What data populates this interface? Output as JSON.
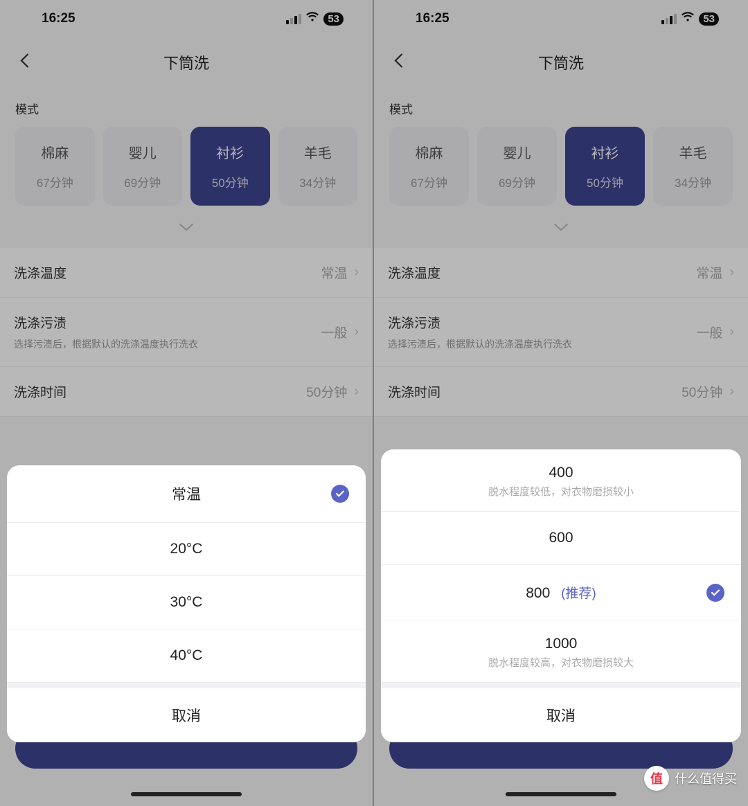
{
  "status": {
    "time": "16:25",
    "battery": "53"
  },
  "nav": {
    "title": "下筒洗"
  },
  "mode_section": {
    "label": "模式",
    "cards": [
      {
        "name": "棉麻",
        "time": "67分钟"
      },
      {
        "name": "婴儿",
        "time": "69分钟"
      },
      {
        "name": "衬衫",
        "time": "50分钟"
      },
      {
        "name": "羊毛",
        "time": "34分钟"
      }
    ]
  },
  "settings": {
    "wash_temp_label": "洗涤温度",
    "wash_temp_value": "常温",
    "wash_stain_label": "洗涤污渍",
    "wash_stain_desc": "选择污渍后，根据默认的洗涤温度执行洗衣",
    "wash_stain_value": "一般",
    "wash_time_label": "洗涤时间",
    "wash_time_value": "50分钟"
  },
  "sheet_left": {
    "items": [
      {
        "label": "常温",
        "checked": true
      },
      {
        "label": "20°C"
      },
      {
        "label": "30°C"
      },
      {
        "label": "40°C"
      }
    ],
    "cancel": "取消"
  },
  "sheet_right": {
    "items": [
      {
        "label": "400",
        "desc": "脱水程度较低，对衣物磨损较小"
      },
      {
        "label": "600"
      },
      {
        "label": "800",
        "recommend": "(推荐)",
        "checked": true
      },
      {
        "label": "1000",
        "desc": "脱水程度较高，对衣物磨损较大"
      }
    ],
    "cancel": "取消"
  },
  "brand": {
    "glyph": "值",
    "text": "什么值得买"
  }
}
